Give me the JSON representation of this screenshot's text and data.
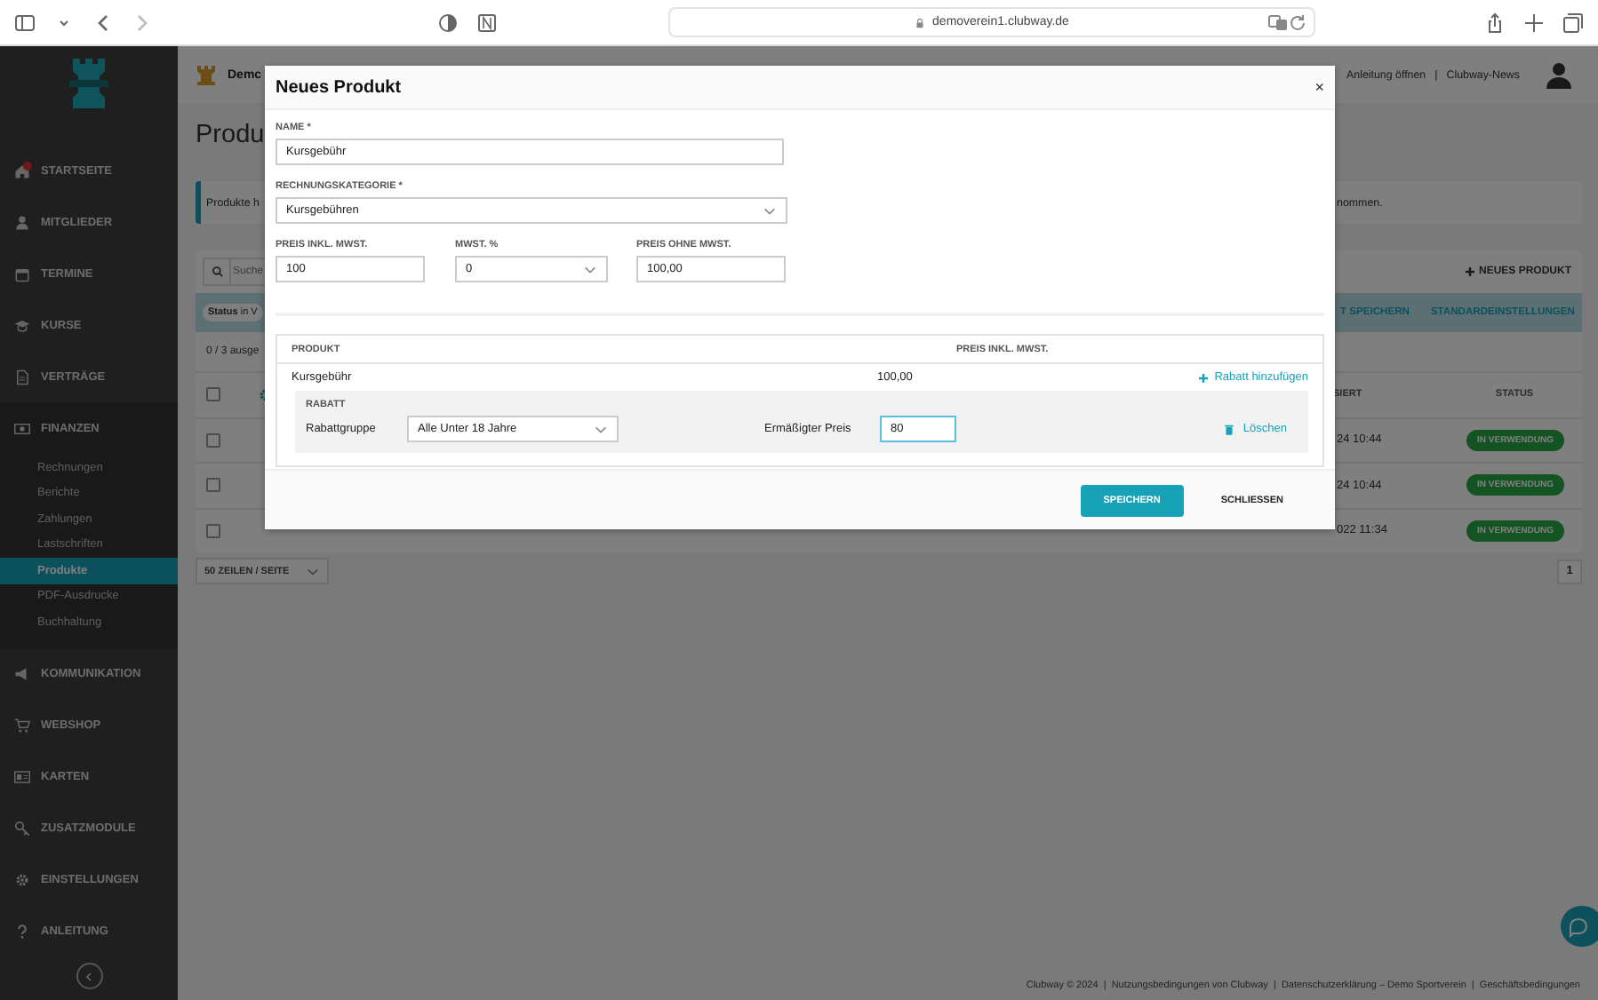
{
  "browser": {
    "url": "demoverein1.clubway.de"
  },
  "sidebar": {
    "items": [
      {
        "label": "STARTSEITE",
        "alert": true,
        "expanded": false
      },
      {
        "label": "MITGLIEDER",
        "alert": false,
        "expanded": false
      },
      {
        "label": "TERMINE",
        "alert": false,
        "expanded": false
      },
      {
        "label": "KURSE",
        "alert": false,
        "expanded": false
      },
      {
        "label": "VERTRÄGE",
        "alert": false,
        "expanded": false
      },
      {
        "label": "FINANZEN",
        "alert": false,
        "expanded": true,
        "children": [
          {
            "label": "Rechnungen",
            "selected": false
          },
          {
            "label": "Berichte",
            "selected": false
          },
          {
            "label": "Zahlungen",
            "selected": false
          },
          {
            "label": "Lastschriften",
            "selected": false
          },
          {
            "label": "Produkte",
            "selected": true
          },
          {
            "label": "PDF-Ausdrucke",
            "selected": false
          },
          {
            "label": "Buchhaltung",
            "selected": false
          }
        ]
      },
      {
        "label": "KOMMUNIKATION",
        "alert": false,
        "expanded": false
      },
      {
        "label": "WEBSHOP",
        "alert": false,
        "expanded": false
      },
      {
        "label": "KARTEN",
        "alert": false,
        "expanded": false
      },
      {
        "label": "ZUSATZMODULE",
        "alert": false,
        "expanded": false
      },
      {
        "label": "EINSTELLUNGEN",
        "alert": false,
        "expanded": false
      },
      {
        "label": "ANLEITUNG",
        "alert": false,
        "expanded": false
      }
    ]
  },
  "topbar": {
    "brand": "Demc",
    "links": [
      "Anleitung öffnen",
      "Clubway-News"
    ],
    "separator": "|"
  },
  "page": {
    "title": "Produ",
    "info_start": "Produkte h",
    "info_end": "nommen.",
    "search": {
      "placeholder": "Suche"
    },
    "new_button": "NEUES PRODUKT",
    "filter_chip": "**Status** in V",
    "filter_actions": [
      "T SPEICHERN",
      "STANDARDEINSTELLUNGEN"
    ],
    "selection_count": "0 / 3 ausge",
    "table": {
      "header_checked": false,
      "columns": [
        "SIERT",
        "STATUS"
      ],
      "rows": [
        {
          "checked": false,
          "cells": [
            "24 10:44",
            "IN VERWENDUNG"
          ]
        },
        {
          "checked": false,
          "cells": [
            "24 10:44",
            "IN VERWENDUNG"
          ]
        },
        {
          "checked": false,
          "cells": [
            "022 11:34",
            "IN VERWENDUNG"
          ]
        }
      ]
    },
    "page_size": "50 ZEILEN / SEITE",
    "pages": [
      {
        "label": "1",
        "selected": true
      }
    ]
  },
  "footer": "Clubway © 2024  |  Nutzungsbedingungen von Clubway  |  Datenschutzerklärung – Demo Sportverein  |  Geschäftsbedingungen",
  "modal": {
    "title": "Neues Produkt",
    "close": "×",
    "name": {
      "label": "NAME *",
      "value": "Kursgebühr"
    },
    "category": {
      "label": "RECHNUNGSKATEGORIE *",
      "value": "Kursgebühren"
    },
    "price_gross": {
      "label": "PREIS INKL. MWST.",
      "value": "100"
    },
    "vat": {
      "label": "MWST. %",
      "value": "0"
    },
    "price_net": {
      "label": "PREIS OHNE MWST.",
      "value": "100,00"
    },
    "products": {
      "columns": [
        "PRODUKT",
        "PREIS INKL. MWST."
      ],
      "rows": [
        {
          "name": "Kursgebühr",
          "price": "100,00",
          "add_discount": "Rabatt hinzufügen",
          "discounts": [
            {
              "title": "RABATT",
              "group_label": "Rabattgruppe",
              "group_value": "Alle Unter 18 Jahre",
              "price_label": "Ermäßigter Preis",
              "price_value": "80",
              "focused": true,
              "delete": "Löschen"
            }
          ]
        }
      ]
    },
    "buttons": [
      {
        "label": "SPEICHERN",
        "kind": "primary"
      },
      {
        "label": "SCHLIESSEN",
        "kind": "plain"
      }
    ]
  }
}
